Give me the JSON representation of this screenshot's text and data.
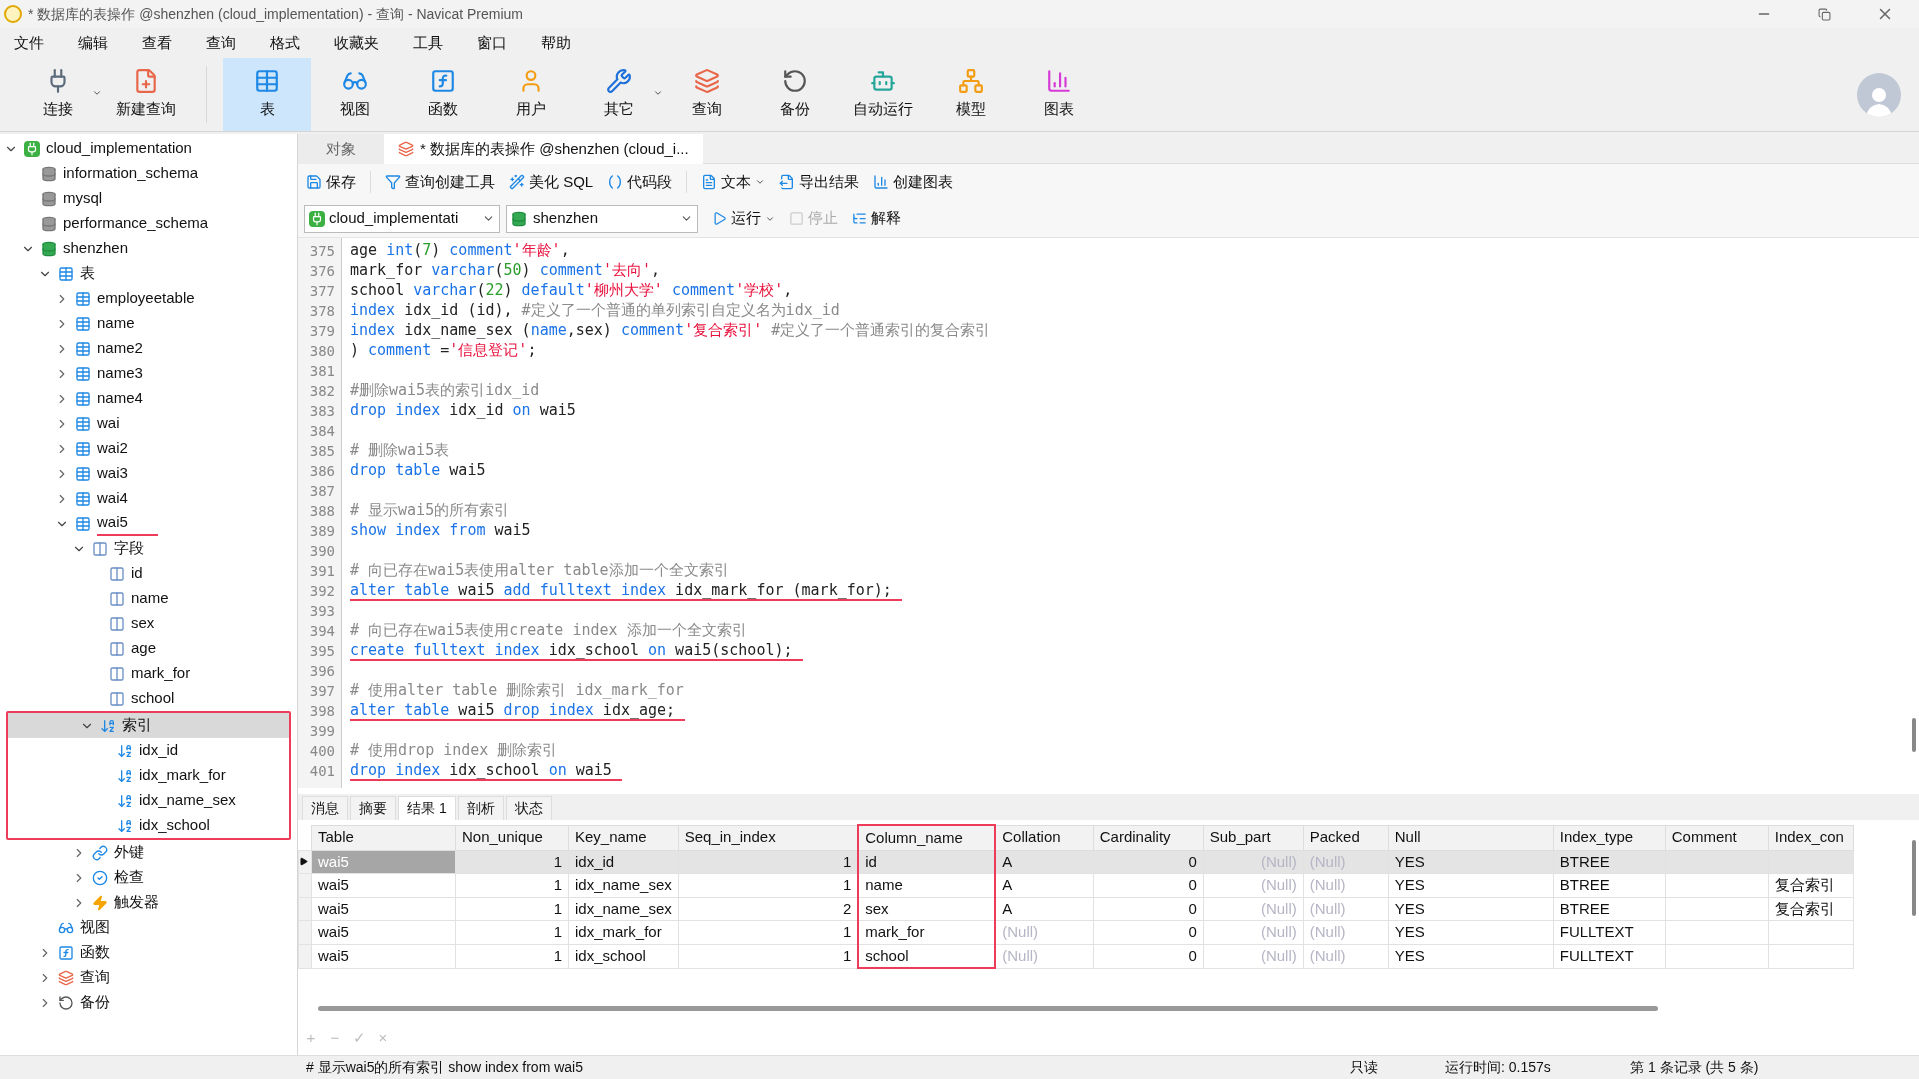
{
  "window": {
    "title": "* 数据库的表操作 @shenzhen (cloud_implementation) - 查询 - Navicat Premium"
  },
  "menu": [
    "文件",
    "编辑",
    "查看",
    "查询",
    "格式",
    "收藏夹",
    "工具",
    "窗口",
    "帮助"
  ],
  "toolbar": [
    {
      "label": "连接",
      "kind": "connect",
      "selected": false,
      "dropdown": true
    },
    {
      "label": "新建查询",
      "kind": "new-query",
      "selected": false,
      "dropdown": false
    },
    {
      "label": "表",
      "kind": "table",
      "selected": true,
      "dropdown": false
    },
    {
      "label": "视图",
      "kind": "view",
      "selected": false,
      "dropdown": false
    },
    {
      "label": "函数",
      "kind": "function",
      "selected": false,
      "dropdown": false
    },
    {
      "label": "用户",
      "kind": "user",
      "selected": false,
      "dropdown": false
    },
    {
      "label": "其它",
      "kind": "other",
      "selected": false,
      "dropdown": true
    },
    {
      "label": "查询",
      "kind": "query",
      "selected": false,
      "dropdown": false
    },
    {
      "label": "备份",
      "kind": "backup",
      "selected": false,
      "dropdown": false
    },
    {
      "label": "自动运行",
      "kind": "automation",
      "selected": false,
      "dropdown": false
    },
    {
      "label": "模型",
      "kind": "model",
      "selected": false,
      "dropdown": false
    },
    {
      "label": "图表",
      "kind": "chart",
      "selected": false,
      "dropdown": false
    }
  ],
  "tree": [
    {
      "label": "cloud_implementation",
      "kind": "connection",
      "expanded": true,
      "selected": false,
      "children": [
        {
          "label": "information_schema",
          "kind": "database",
          "selected": false
        },
        {
          "label": "mysql",
          "kind": "database",
          "selected": false
        },
        {
          "label": "performance_schema",
          "kind": "database",
          "selected": false
        },
        {
          "label": "shenzhen",
          "kind": "database-open",
          "expanded": true,
          "selected": false,
          "children": [
            {
              "label": "表",
              "kind": "tables",
              "expanded": true,
              "selected": false,
              "children": [
                {
                  "label": "employeetable",
                  "kind": "table",
                  "expanded": false,
                  "selected": false
                },
                {
                  "label": "name",
                  "kind": "table",
                  "expanded": false,
                  "selected": false
                },
                {
                  "label": "name2",
                  "kind": "table",
                  "expanded": false,
                  "selected": false
                },
                {
                  "label": "name3",
                  "kind": "table",
                  "expanded": false,
                  "selected": false
                },
                {
                  "label": "name4",
                  "kind": "table",
                  "expanded": false,
                  "selected": false
                },
                {
                  "label": "wai",
                  "kind": "table",
                  "expanded": false,
                  "selected": false
                },
                {
                  "label": "wai2",
                  "kind": "table",
                  "expanded": false,
                  "selected": false
                },
                {
                  "label": "wai3",
                  "kind": "table",
                  "expanded": false,
                  "selected": false
                },
                {
                  "label": "wai4",
                  "kind": "table",
                  "expanded": false,
                  "selected": false
                },
                {
                  "label": "wai5",
                  "kind": "table",
                  "expanded": true,
                  "selected": false,
                  "underlined": true,
                  "children": [
                    {
                      "label": "字段",
                      "kind": "fields",
                      "expanded": true,
                      "selected": false,
                      "children": [
                        {
                          "label": "id",
                          "kind": "field",
                          "selected": false
                        },
                        {
                          "label": "name",
                          "kind": "field",
                          "selected": false
                        },
                        {
                          "label": "sex",
                          "kind": "field",
                          "selected": false
                        },
                        {
                          "label": "age",
                          "kind": "field",
                          "selected": false
                        },
                        {
                          "label": "mark_for",
                          "kind": "field",
                          "selected": false
                        },
                        {
                          "label": "school",
                          "kind": "field",
                          "selected": false
                        }
                      ]
                    },
                    {
                      "label": "索引",
                      "kind": "index",
                      "expanded": true,
                      "selected": true,
                      "boxed": true,
                      "children": [
                        {
                          "label": "idx_id",
                          "kind": "index",
                          "selected": false
                        },
                        {
                          "label": "idx_mark_for",
                          "kind": "index",
                          "selected": false
                        },
                        {
                          "label": "idx_name_sex",
                          "kind": "index",
                          "selected": false
                        },
                        {
                          "label": "idx_school",
                          "kind": "index",
                          "selected": false
                        }
                      ]
                    },
                    {
                      "label": "外键",
                      "kind": "foreign-key",
                      "expanded": false,
                      "selected": false
                    },
                    {
                      "label": "检查",
                      "kind": "check",
                      "expanded": false,
                      "selected": false
                    },
                    {
                      "label": "触发器",
                      "kind": "trigger",
                      "expanded": false,
                      "selected": false
                    }
                  ]
                }
              ]
            },
            {
              "label": "视图",
              "kind": "views",
              "selected": false
            },
            {
              "label": "函数",
              "kind": "functions",
              "expanded": false,
              "selected": false
            },
            {
              "label": "查询",
              "kind": "queries",
              "expanded": false,
              "selected": false
            },
            {
              "label": "备份",
              "kind": "backups",
              "expanded": false,
              "selected": false
            }
          ]
        }
      ]
    }
  ],
  "editor_tabs": [
    {
      "label": "对象",
      "selected": false,
      "icon": false
    },
    {
      "label": "* 数据库的表操作 @shenzhen (cloud_i...",
      "selected": true,
      "icon": true
    }
  ],
  "editor_toolbar": [
    {
      "label": "保存",
      "kind": "save",
      "dropdown": false
    },
    {
      "label": "查询创建工具",
      "kind": "builder",
      "dropdown": false
    },
    {
      "label": "美化 SQL",
      "kind": "beautify",
      "dropdown": false
    },
    {
      "label": "代码段",
      "kind": "snippet",
      "dropdown": false
    },
    {
      "label": "文本",
      "kind": "text",
      "dropdown": true
    },
    {
      "label": "导出结果",
      "kind": "export",
      "dropdown": false
    },
    {
      "label": "创建图表",
      "kind": "chart",
      "dropdown": false
    }
  ],
  "connection_select": "cloud_implementati",
  "database_select": "shenzhen",
  "run_controls": [
    {
      "label": "运行",
      "kind": "run",
      "disabled": false,
      "dropdown": true
    },
    {
      "label": "停止",
      "kind": "stop",
      "disabled": true,
      "dropdown": false
    },
    {
      "label": "解释",
      "kind": "explain",
      "disabled": false,
      "dropdown": false
    }
  ],
  "code": [
    {
      "n": "375",
      "tokens": [
        {
          "kind": "plain",
          "text": "age "
        },
        {
          "kind": "keyword",
          "text": "int"
        },
        {
          "kind": "plain",
          "text": "("
        },
        {
          "kind": "number",
          "text": "7"
        },
        {
          "kind": "plain",
          "text": ") "
        },
        {
          "kind": "keyword",
          "text": "comment"
        },
        {
          "kind": "string",
          "text": "'年龄'"
        },
        {
          "kind": "plain",
          "text": ","
        }
      ]
    },
    {
      "n": "376",
      "tokens": [
        {
          "kind": "plain",
          "text": "mark_for "
        },
        {
          "kind": "keyword",
          "text": "varchar"
        },
        {
          "kind": "plain",
          "text": "("
        },
        {
          "kind": "number",
          "text": "50"
        },
        {
          "kind": "plain",
          "text": ") "
        },
        {
          "kind": "keyword",
          "text": "comment"
        },
        {
          "kind": "string",
          "text": "'去向'"
        },
        {
          "kind": "plain",
          "text": ","
        }
      ]
    },
    {
      "n": "377",
      "tokens": [
        {
          "kind": "plain",
          "text": "school "
        },
        {
          "kind": "keyword",
          "text": "varchar"
        },
        {
          "kind": "plain",
          "text": "("
        },
        {
          "kind": "number",
          "text": "22"
        },
        {
          "kind": "plain",
          "text": ") "
        },
        {
          "kind": "keyword",
          "text": "default"
        },
        {
          "kind": "string",
          "text": "'柳州大学' "
        },
        {
          "kind": "keyword",
          "text": "comment"
        },
        {
          "kind": "string",
          "text": "'学校'"
        },
        {
          "kind": "plain",
          "text": ","
        }
      ]
    },
    {
      "n": "378",
      "tokens": [
        {
          "kind": "keyword",
          "text": "index"
        },
        {
          "kind": "plain",
          "text": " idx_id (id), "
        },
        {
          "kind": "comment",
          "text": "#定义了一个普通的单列索引自定义名为idx_id"
        }
      ]
    },
    {
      "n": "379",
      "tokens": [
        {
          "kind": "keyword",
          "text": "index"
        },
        {
          "kind": "plain",
          "text": " idx_name_sex ("
        },
        {
          "kind": "keyword",
          "text": "name"
        },
        {
          "kind": "plain",
          "text": ",sex) "
        },
        {
          "kind": "keyword",
          "text": "comment"
        },
        {
          "kind": "string",
          "text": "'复合索引' "
        },
        {
          "kind": "comment",
          "text": "#定义了一个普通索引的复合索引"
        }
      ]
    },
    {
      "n": "380",
      "tokens": [
        {
          "kind": "plain",
          "text": ") "
        },
        {
          "kind": "keyword",
          "text": "comment"
        },
        {
          "kind": "plain",
          "text": " ="
        },
        {
          "kind": "string",
          "text": "'信息登记'"
        },
        {
          "kind": "plain",
          "text": ";"
        }
      ]
    },
    {
      "n": "381"
    },
    {
      "n": "382",
      "tokens": [
        {
          "kind": "comment",
          "text": "#删除wai5表的索引idx_id"
        }
      ]
    },
    {
      "n": "383",
      "tokens": [
        {
          "kind": "keyword",
          "text": "drop index"
        },
        {
          "kind": "plain",
          "text": " idx_id "
        },
        {
          "kind": "keyword",
          "text": "on"
        },
        {
          "kind": "plain",
          "text": " wai5"
        }
      ]
    },
    {
      "n": "384"
    },
    {
      "n": "385",
      "tokens": [
        {
          "kind": "comment",
          "text": "# 删除wai5表"
        }
      ]
    },
    {
      "n": "386",
      "tokens": [
        {
          "kind": "keyword",
          "text": "drop table"
        },
        {
          "kind": "plain",
          "text": " wai5"
        }
      ]
    },
    {
      "n": "387"
    },
    {
      "n": "388",
      "tokens": [
        {
          "kind": "comment",
          "text": "# 显示wai5的所有索引"
        }
      ]
    },
    {
      "n": "389",
      "tokens": [
        {
          "kind": "keyword",
          "text": "show index from"
        },
        {
          "kind": "plain",
          "text": " wai5"
        }
      ]
    },
    {
      "n": "390"
    },
    {
      "n": "391",
      "tokens": [
        {
          "kind": "comment",
          "text": "# 向已存在wai5表使用alter table添加一个全文索引"
        }
      ]
    },
    {
      "n": "392",
      "underlined": true,
      "tokens": [
        {
          "kind": "keyword",
          "text": "alter table"
        },
        {
          "kind": "plain",
          "text": " wai5 "
        },
        {
          "kind": "keyword",
          "text": "add fulltext index"
        },
        {
          "kind": "plain",
          "text": " idx_mark_for (mark_for);"
        }
      ]
    },
    {
      "n": "393"
    },
    {
      "n": "394",
      "tokens": [
        {
          "kind": "comment",
          "text": "# 向已存在wai5表使用create index 添加一个全文索引"
        }
      ]
    },
    {
      "n": "395",
      "underlined": true,
      "tokens": [
        {
          "kind": "keyword",
          "text": "create fulltext index"
        },
        {
          "kind": "plain",
          "text": " idx_school "
        },
        {
          "kind": "keyword",
          "text": "on"
        },
        {
          "kind": "plain",
          "text": " wai5(school);"
        }
      ]
    },
    {
      "n": "396"
    },
    {
      "n": "397",
      "tokens": [
        {
          "kind": "comment",
          "text": "# 使用alter table 删除索引 idx_mark_for"
        }
      ]
    },
    {
      "n": "398",
      "underlined": true,
      "tokens": [
        {
          "kind": "keyword",
          "text": "alter table"
        },
        {
          "kind": "plain",
          "text": " wai5 "
        },
        {
          "kind": "keyword",
          "text": "drop index"
        },
        {
          "kind": "plain",
          "text": " idx_age;"
        }
      ]
    },
    {
      "n": "399"
    },
    {
      "n": "400",
      "tokens": [
        {
          "kind": "comment",
          "text": "# 使用drop index 删除索引"
        }
      ]
    },
    {
      "n": "401",
      "underlined": true,
      "tokens": [
        {
          "kind": "keyword",
          "text": "drop index"
        },
        {
          "kind": "plain",
          "text": " idx_school "
        },
        {
          "kind": "keyword",
          "text": "on"
        },
        {
          "kind": "plain",
          "text": " wai5"
        }
      ]
    }
  ],
  "result_tabs": [
    {
      "label": "消息",
      "selected": false
    },
    {
      "label": "摘要",
      "selected": false
    },
    {
      "label": "结果 1",
      "selected": true
    },
    {
      "label": "剖析",
      "selected": false
    },
    {
      "label": "状态",
      "selected": false
    }
  ],
  "result_columns": [
    {
      "label": "Table",
      "boxed": false
    },
    {
      "label": "Non_unique",
      "boxed": false
    },
    {
      "label": "Key_name",
      "boxed": false
    },
    {
      "label": "Seq_in_index",
      "boxed": false
    },
    {
      "label": "Column_name",
      "boxed": true
    },
    {
      "label": "Collation",
      "boxed": false
    },
    {
      "label": "Cardinality",
      "boxed": false
    },
    {
      "label": "Sub_part",
      "boxed": false
    },
    {
      "label": "Packed",
      "boxed": false
    },
    {
      "label": "Null",
      "boxed": false
    },
    {
      "label": "Index_type",
      "boxed": false
    },
    {
      "label": "Comment",
      "boxed": false
    },
    {
      "label": "Index_con",
      "boxed": false
    }
  ],
  "result_rows": [
    {
      "selected": true,
      "cells": [
        "wai5",
        "1",
        "idx_id",
        "1",
        "id",
        "A",
        "0",
        {
          "text": "(Null)",
          "is_null": true
        },
        {
          "text": "(Null)",
          "is_null": true
        },
        "YES",
        "BTREE",
        "",
        ""
      ]
    },
    {
      "selected": false,
      "cells": [
        "wai5",
        "1",
        "idx_name_sex",
        "1",
        "name",
        "A",
        "0",
        {
          "text": "(Null)",
          "is_null": true
        },
        {
          "text": "(Null)",
          "is_null": true
        },
        "YES",
        "BTREE",
        "",
        "复合索引"
      ]
    },
    {
      "selected": false,
      "cells": [
        "wai5",
        "1",
        "idx_name_sex",
        "2",
        "sex",
        "A",
        "0",
        {
          "text": "(Null)",
          "is_null": true
        },
        {
          "text": "(Null)",
          "is_null": true
        },
        "YES",
        "BTREE",
        "",
        "复合索引"
      ]
    },
    {
      "selected": false,
      "cells": [
        "wai5",
        "1",
        "idx_mark_for",
        "1",
        "mark_for",
        {
          "text": "(Null)",
          "is_null": true
        },
        "0",
        {
          "text": "(Null)",
          "is_null": true
        },
        {
          "text": "(Null)",
          "is_null": true
        },
        "YES",
        "FULLTEXT",
        "",
        ""
      ]
    },
    {
      "selected": false,
      "cells": [
        "wai5",
        "1",
        "idx_school",
        "1",
        "school",
        {
          "text": "(Null)",
          "is_null": true
        },
        "0",
        {
          "text": "(Null)",
          "is_null": true
        },
        {
          "text": "(Null)",
          "is_null": true
        },
        "YES",
        "FULLTEXT",
        "",
        ""
      ]
    }
  ],
  "record_tools": [
    "+",
    "−",
    "✓",
    "×"
  ],
  "status_bar": {
    "query": "# 显示wai5的所有索引 show index from wai5",
    "mode": "只读",
    "time": "运行时间: 0.157s",
    "records": "第 1 条记录 (共 5 条)"
  }
}
